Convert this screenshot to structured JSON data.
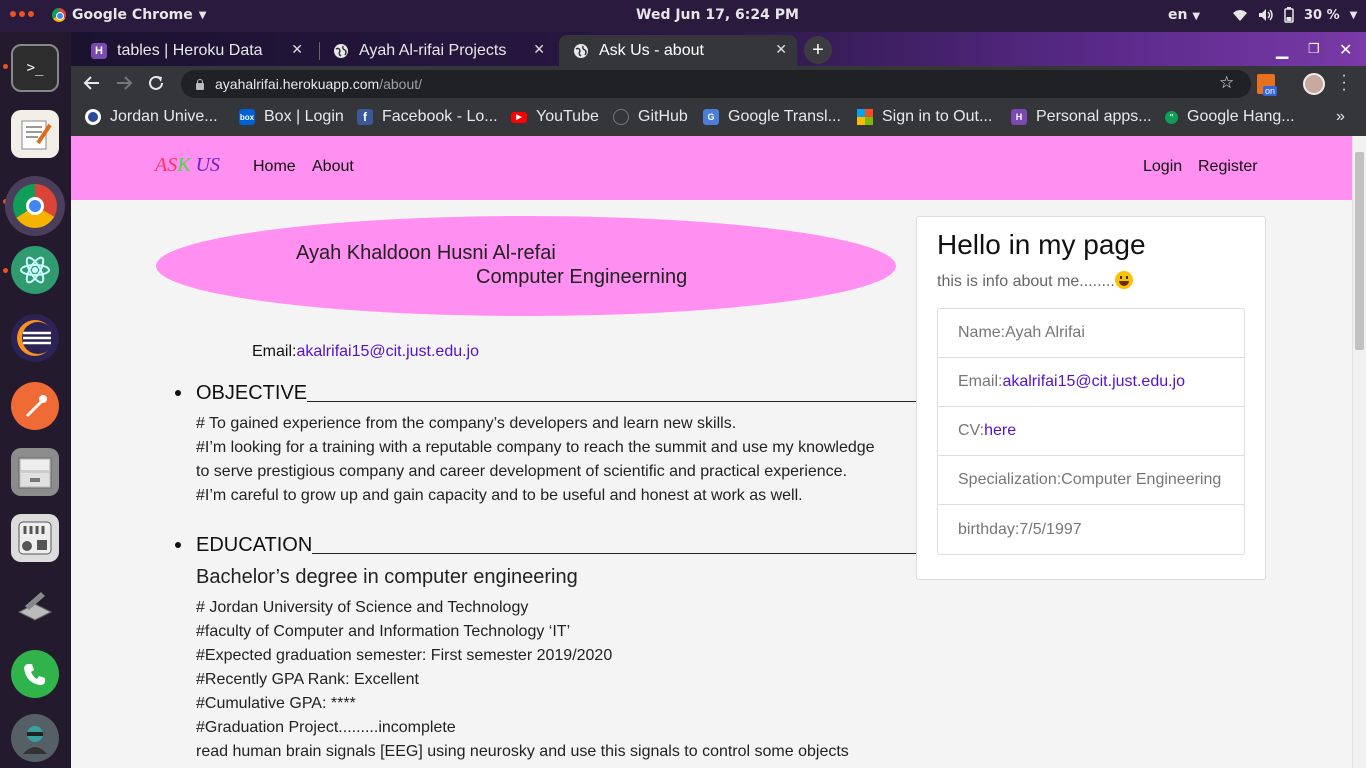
{
  "os": {
    "app_name": "Google Chrome",
    "clock": "Wed Jun 17,  6:24 PM",
    "lang": "en",
    "battery": "30 %"
  },
  "browser": {
    "tabs": [
      {
        "title": "tables | Heroku Data"
      },
      {
        "title": "Ayah Al-rifai Projects"
      },
      {
        "title": "Ask Us - about"
      }
    ],
    "url_host": "ayahalrifai.herokuapp.com",
    "url_path": "/about/",
    "ext_badge": "on",
    "bookmarks": [
      {
        "label": "Jordan Unive..."
      },
      {
        "label": "Box | Login"
      },
      {
        "label": "Facebook - Lo..."
      },
      {
        "label": "YouTube"
      },
      {
        "label": "GitHub"
      },
      {
        "label": "Google Transl..."
      },
      {
        "label": "Sign in to Out..."
      },
      {
        "label": "Personal apps..."
      },
      {
        "label": "Google Hang..."
      }
    ]
  },
  "site": {
    "brand": {
      "a": "A",
      "s": "S",
      "k": "K",
      "space": " ",
      "us": "US"
    },
    "nav": {
      "home": "Home",
      "about": "About",
      "login": "Login",
      "register": "Register"
    },
    "hero": {
      "name": "Ayah Khaldoon Husni Al-refai",
      "major": "Computer Engineerning"
    },
    "email_label": "Email:",
    "email": "akalrifai15@cit.just.edu.jo",
    "objective": {
      "heading": "OBJECTIVE",
      "lines": [
        "# To gained experience from the company’s developers and learn new skills.",
        "#I’m looking for a training with a reputable company to reach the summit and use my knowledge",
        "to serve prestigious company and career development of scientific and practical experience.",
        "#I’m careful to grow up and gain capacity and to be useful and honest at work as well."
      ]
    },
    "education": {
      "heading": "EDUCATION",
      "degree": "Bachelor’s degree in computer engineering",
      "lines": [
        "# Jordan University of Science and Technology",
        "#faculty of Computer and Information Technology ‘IT’",
        "#Expected graduation semester: First semester 2019/2020",
        "#Recently GPA Rank: Excellent",
        "#Cumulative GPA: ****",
        "#Graduation Project.........incomplete",
        "read human brain signals [EEG] using neurosky and use this signals to control some objects"
      ]
    },
    "card": {
      "title": "Hello in my page",
      "subtitle": "this is info about me........",
      "name": "Name:Ayah Alrifai",
      "email_label": "Email:",
      "email": "akalrifai15@cit.just.edu.jo",
      "cv_label": "CV:",
      "cv_link": "here",
      "specialization": "Specialization:Computer Engineering",
      "birthday": "birthday:7/5/1997"
    }
  }
}
